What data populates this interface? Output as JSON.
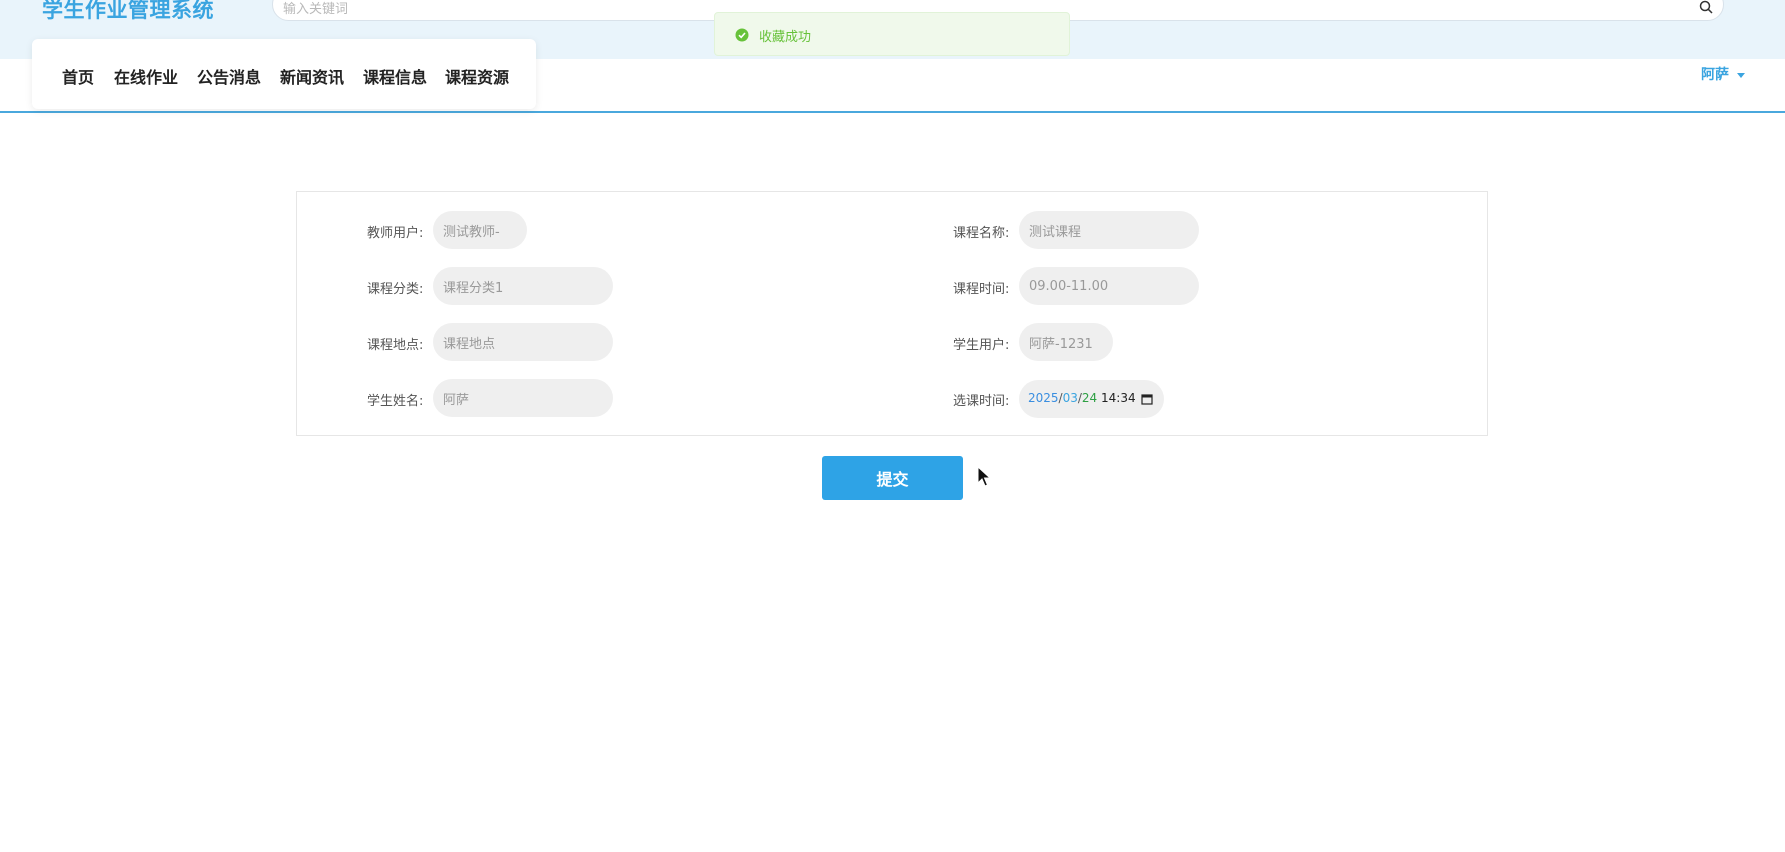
{
  "header": {
    "site_title": "学生作业管理系统",
    "search_placeholder": "输入关键词"
  },
  "toast": {
    "message": "收藏成功",
    "color": "#67c23a"
  },
  "nav": {
    "items": [
      {
        "label": "首页"
      },
      {
        "label": "在线作业"
      },
      {
        "label": "公告消息"
      },
      {
        "label": "新闻资讯"
      },
      {
        "label": "课程信息"
      },
      {
        "label": "课程资源"
      }
    ],
    "user": "阿萨"
  },
  "form": {
    "fields": [
      {
        "label": "教师用户:",
        "value": "测试教师-"
      },
      {
        "label": "课程名称:",
        "value": "测试课程"
      },
      {
        "label": "课程分类:",
        "value": "课程分类1"
      },
      {
        "label": "课程时间:",
        "value": "09.00-11.00"
      },
      {
        "label": "课程地点:",
        "value": "课程地点"
      },
      {
        "label": "学生用户:",
        "value": "阿萨-1231"
      },
      {
        "label": "学生姓名:",
        "value": "阿萨"
      },
      {
        "label": "选课时间:",
        "date": {
          "year": "2025",
          "month": "03",
          "day": "24",
          "time": "14:34"
        }
      }
    ],
    "submit_label": "提交"
  },
  "colors": {
    "accent": "#2ea3e6",
    "header_bg": "#e9f4fb"
  }
}
